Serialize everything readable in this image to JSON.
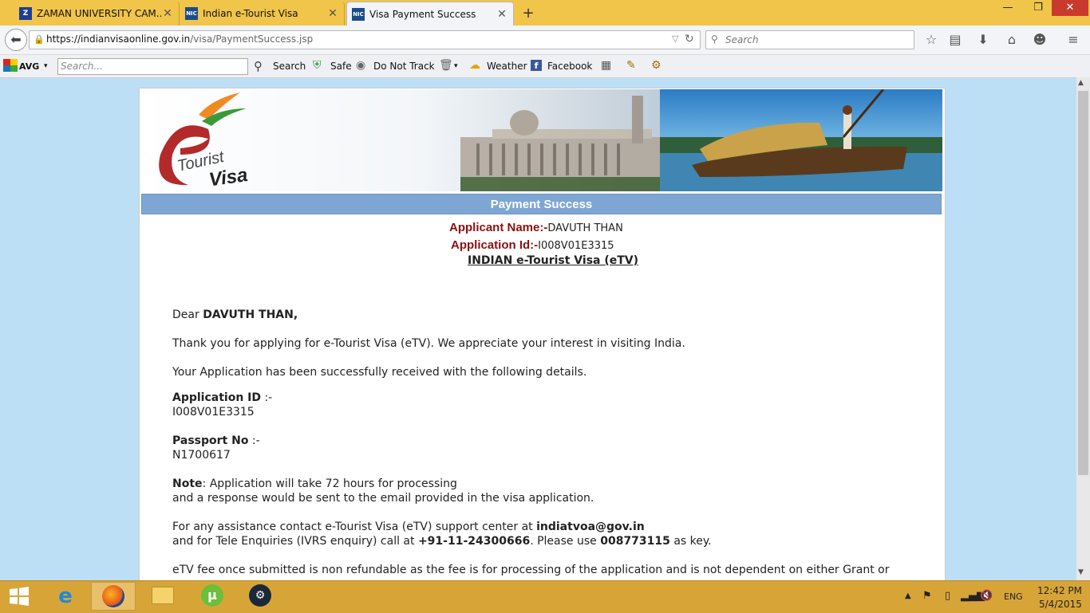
{
  "browser": {
    "tabs": [
      {
        "title": "ZAMAN UNIVERSITY CAM...",
        "favicon": "Z"
      },
      {
        "title": "Indian e-Tourist Visa",
        "favicon": "NIC"
      },
      {
        "title": "Visa Payment Success",
        "favicon": "NIC",
        "active": true
      }
    ],
    "url_domain": "https://indianvisaonline.gov.in",
    "url_path": "/visa/PaymentSuccess.jsp",
    "search_placeholder": "Search"
  },
  "toolbar": {
    "avg_label": "AVG",
    "search_placeholder": "Search...",
    "search_label": "Search",
    "safe_label": "Safe",
    "dnt_label": "Do Not Track",
    "weather_label": "Weather",
    "facebook_label": "Facebook"
  },
  "page": {
    "logo_text_1": "Tourist",
    "logo_text_2": "Visa",
    "header": "Payment Success",
    "applicant_name_label": "Applicant Name:-",
    "applicant_name": "DAVUTH THAN",
    "application_id_label": "Application Id:-",
    "application_id": "I008V01E3315",
    "visa_title": "INDIAN e-Tourist Visa (eTV)",
    "dear": "Dear ",
    "dear_name": "DAVUTH THAN,",
    "thanks": "Thank you for applying for e-Tourist Visa (eTV). We appreciate your interest in visiting India.",
    "received": "Your Application has been successfully received with the following details.",
    "appid_heading": "Application ID",
    "appid_sep": " :-",
    "appid_value": "I008V01E3315",
    "passport_heading": "Passport No",
    "passport_sep": " :-",
    "passport_value": "N1700617",
    "note_label": "Note",
    "note_text": ": Application will take 72 hours for processing",
    "note_text_2": "and a response would be sent to the email provided in the visa application.",
    "assist_1": "For any assistance contact e-Tourist Visa (eTV) support center at ",
    "assist_email": "indiatvoa@gov.in",
    "assist_2": "and for Tele Enquiries (IVRS enquiry) call at ",
    "assist_phone": "+91-11-24300666",
    "assist_3": ". Please use ",
    "assist_key": "008773115",
    "assist_4": " as key.",
    "fee_text": "eTV fee once submitted is non refundable as the fee is for processing of the application and is not dependent on either Grant or"
  },
  "taskbar": {
    "time": "12:42 PM",
    "date": "5/4/2015",
    "lang": "ENG"
  },
  "colors": {
    "tabbar": "#f1c54a",
    "taskbar": "#d7a537",
    "header_bar": "#7ea6d3",
    "label_red": "#8a1010"
  }
}
